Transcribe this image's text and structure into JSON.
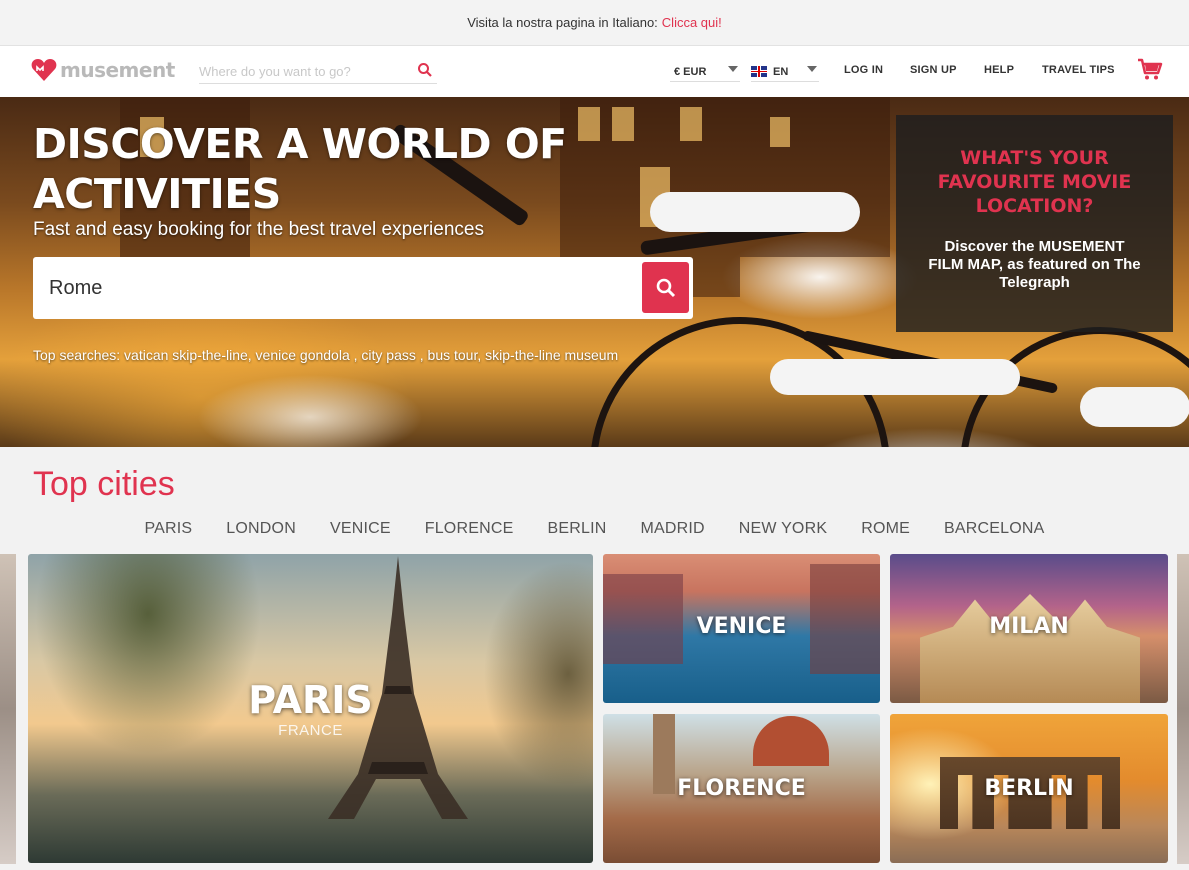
{
  "topbar": {
    "text": "Visita la nostra pagina in Italiano:",
    "link": "Clicca qui!"
  },
  "header": {
    "logo_text": "musement",
    "search_placeholder": "Where do you want to go?",
    "currency": "€ EUR",
    "language": "EN",
    "nav": [
      "LOG IN",
      "SIGN UP",
      "HELP",
      "TRAVEL TIPS"
    ]
  },
  "hero": {
    "title": "DISCOVER A WORLD OF ACTIVITIES",
    "subtitle": "Fast and easy booking for the best travel experiences",
    "search_value": "Rome",
    "top_searches": "Top searches: vatican skip-the-line, venice gondola , city pass , bus tour, skip-the-line museum",
    "promo_title": "WHAT'S YOUR FAVOURITE MOVIE LOCATION?",
    "promo_text": "Discover the MUSEMENT FILM MAP, as featured on The Telegraph"
  },
  "top_cities": {
    "title": "Top cities",
    "tabs": [
      "PARIS",
      "LONDON",
      "VENICE",
      "FLORENCE",
      "BERLIN",
      "MADRID",
      "NEW YORK",
      "ROME",
      "BARCELONA"
    ],
    "cards": [
      {
        "name": "PARIS",
        "country": "FRANCE"
      },
      {
        "name": "VENICE"
      },
      {
        "name": "MILAN"
      },
      {
        "name": "FLORENCE"
      },
      {
        "name": "BERLIN"
      }
    ]
  },
  "colors": {
    "accent": "#e0334f",
    "logo_grey": "#b9b9b9"
  }
}
